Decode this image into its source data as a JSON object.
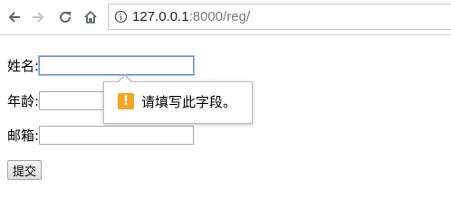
{
  "browser": {
    "url_host": "127.0.0.1",
    "url_rest": ":8000/reg/"
  },
  "form": {
    "name_label": "姓名:",
    "name_value": "",
    "age_label": "年龄:",
    "age_value": "",
    "email_label": "邮箱:",
    "email_value": "",
    "submit_label": "提交"
  },
  "validation": {
    "message": "请填写此字段。",
    "icon_glyph": "!",
    "icon_color": "#f5a623"
  },
  "icons": {
    "back": "back-arrow-icon",
    "forward": "forward-arrow-icon",
    "reload": "reload-icon",
    "home": "home-icon",
    "info": "info-icon",
    "warning": "warning-icon"
  }
}
